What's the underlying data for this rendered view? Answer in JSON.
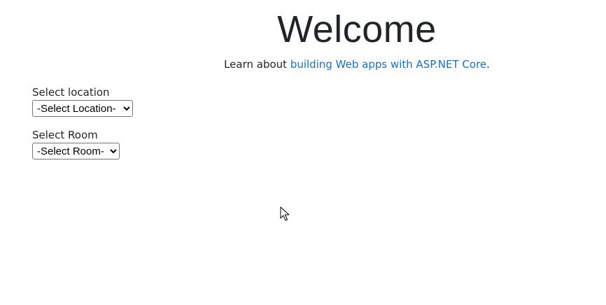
{
  "welcome": {
    "title": "Welcome",
    "subtitle_prefix": "Learn about ",
    "link_text": "building Web apps with ASP.NET Core",
    "subtitle_suffix": "."
  },
  "form": {
    "location": {
      "label": "Select location",
      "selected": "-Select Location-"
    },
    "room": {
      "label": "Select Room",
      "selected": "-Select Room-"
    }
  },
  "colors": {
    "link": "#1b6ec2",
    "text": "#212529"
  },
  "icons": {
    "cursor": "mouse-pointer-icon"
  }
}
